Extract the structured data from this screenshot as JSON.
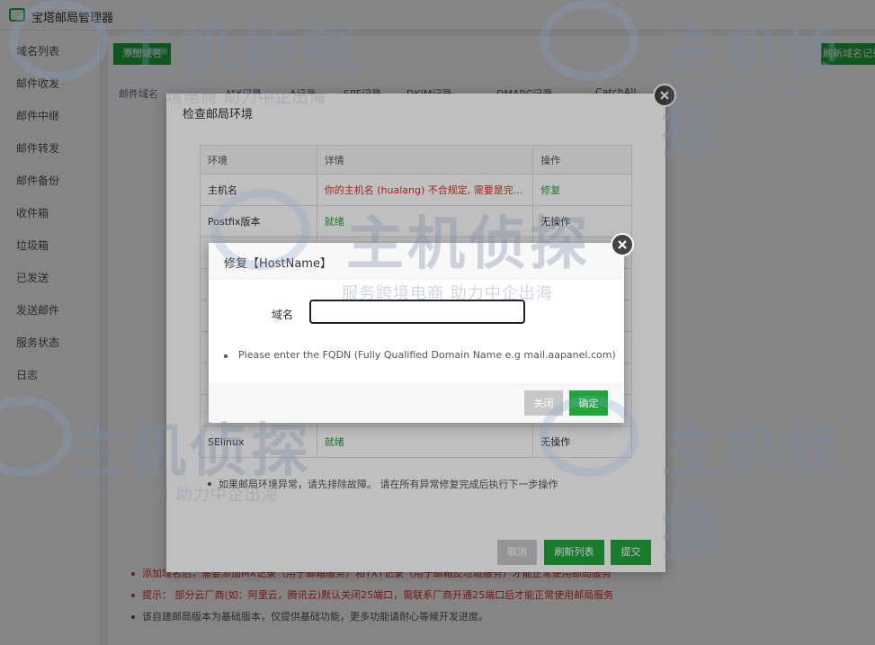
{
  "app": {
    "title": "宝塔邮局管理器"
  },
  "sidebar": {
    "items": [
      "域名列表",
      "邮件收发",
      "邮件中继",
      "邮件转发",
      "邮件备份",
      "收件箱",
      "垃圾箱",
      "已发送",
      "发送邮件",
      "服务状态",
      "日志"
    ]
  },
  "toolbar": {
    "add_domain": "添加域名",
    "refresh_dns": "刷新域名记录"
  },
  "content": {
    "columns": [
      "邮件域名",
      "MX记录",
      "A记录",
      "SPF记录",
      "DKIM记录",
      "DMARC记录",
      "CatchAll"
    ]
  },
  "notes": [
    {
      "text": "添加域名后，需要添加MX记录（用于邮箱服务）和TXT记录（用于邮箱反垃圾服务）才能正常使用邮局服务",
      "color": "red"
    },
    {
      "text": "提示： 部分云厂商(如：阿里云，腾讯云)默认关闭25端口，需联系厂商开通25端口后才能正常使用邮局服务",
      "color": "red"
    },
    {
      "text": "该自建邮局版本为基础版本，仅提供基础功能，更多功能请耐心等候开发进度。",
      "color": "gray"
    }
  ],
  "env_modal": {
    "title": "检查邮局环境",
    "headers": [
      "环境",
      "详情",
      "操作"
    ],
    "rows": [
      {
        "env": "主机名",
        "detail": "你的主机名 (hualang) 不合规定, 需要是完...",
        "action": "修复"
      },
      {
        "env": "Postfix版本",
        "detail": "就绪",
        "action": "无操作"
      },
      {
        "env": "",
        "detail": "",
        "action": ""
      },
      {
        "env": "",
        "detail": "",
        "action": ""
      },
      {
        "env": "",
        "detail": "",
        "action": ""
      },
      {
        "env": "",
        "detail": "",
        "action": ""
      },
      {
        "env": "",
        "detail": "",
        "action": ""
      },
      {
        "env": "",
        "detail": "",
        "action": ""
      },
      {
        "env": "SElinux",
        "detail": "就绪",
        "action": "无操作"
      }
    ],
    "hint": "如果邮局环境异常，请先排除故障。 请在所有异常修复完成后执行下一步操作",
    "buttons": {
      "cancel": "取消",
      "refresh": "刷新列表",
      "submit": "提交"
    }
  },
  "fix_modal": {
    "title": "修复【HostName】",
    "domain_label": "域名",
    "domain_value": "",
    "hint": "Please enter the FQDN (Fully Qualified Domain Name e.g mail.aapanel.com)",
    "buttons": {
      "close": "关闭",
      "confirm": "确定"
    }
  },
  "watermark": {
    "main": "主机侦探",
    "sub": "服务跨境电商 助力中企出海"
  }
}
